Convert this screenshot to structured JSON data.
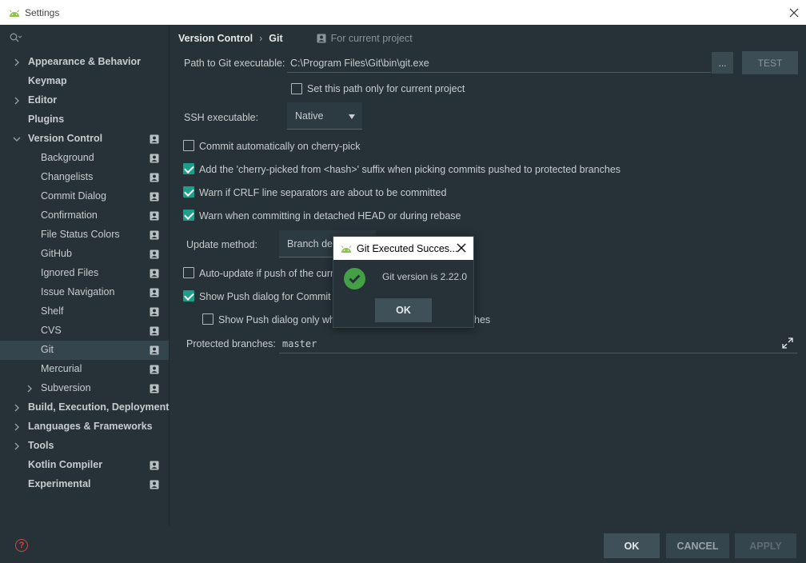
{
  "window": {
    "title": "Settings"
  },
  "sidebar": {
    "items": [
      {
        "label": "Appearance & Behavior",
        "bold": true,
        "level": 0,
        "chevron": "right",
        "project": false
      },
      {
        "label": "Keymap",
        "bold": true,
        "level": 0,
        "chevron": "none",
        "project": false
      },
      {
        "label": "Editor",
        "bold": true,
        "level": 0,
        "chevron": "right",
        "project": false
      },
      {
        "label": "Plugins",
        "bold": true,
        "level": 0,
        "chevron": "none",
        "project": false
      },
      {
        "label": "Version Control",
        "bold": true,
        "level": 0,
        "chevron": "down",
        "project": true
      },
      {
        "label": "Background",
        "bold": false,
        "level": 1,
        "chevron": "none",
        "project": true
      },
      {
        "label": "Changelists",
        "bold": false,
        "level": 1,
        "chevron": "none",
        "project": true
      },
      {
        "label": "Commit Dialog",
        "bold": false,
        "level": 1,
        "chevron": "none",
        "project": true
      },
      {
        "label": "Confirmation",
        "bold": false,
        "level": 1,
        "chevron": "none",
        "project": true
      },
      {
        "label": "File Status Colors",
        "bold": false,
        "level": 1,
        "chevron": "none",
        "project": true
      },
      {
        "label": "GitHub",
        "bold": false,
        "level": 1,
        "chevron": "none",
        "project": true
      },
      {
        "label": "Ignored Files",
        "bold": false,
        "level": 1,
        "chevron": "none",
        "project": true
      },
      {
        "label": "Issue Navigation",
        "bold": false,
        "level": 1,
        "chevron": "none",
        "project": true
      },
      {
        "label": "Shelf",
        "bold": false,
        "level": 1,
        "chevron": "none",
        "project": true
      },
      {
        "label": "CVS",
        "bold": false,
        "level": 1,
        "chevron": "none",
        "project": true
      },
      {
        "label": "Git",
        "bold": false,
        "level": 1,
        "chevron": "none",
        "project": true,
        "selected": true
      },
      {
        "label": "Mercurial",
        "bold": false,
        "level": 1,
        "chevron": "none",
        "project": true
      },
      {
        "label": "Subversion",
        "bold": false,
        "level": 1,
        "chevron": "right",
        "project": true
      },
      {
        "label": "Build, Execution, Deployment",
        "bold": true,
        "level": 0,
        "chevron": "right",
        "project": false
      },
      {
        "label": "Languages & Frameworks",
        "bold": true,
        "level": 0,
        "chevron": "right",
        "project": false
      },
      {
        "label": "Tools",
        "bold": true,
        "level": 0,
        "chevron": "right",
        "project": false
      },
      {
        "label": "Kotlin Compiler",
        "bold": true,
        "level": 0,
        "chevron": "none",
        "project": true
      },
      {
        "label": "Experimental",
        "bold": true,
        "level": 0,
        "chevron": "none",
        "project": true
      }
    ]
  },
  "breadcrumb": {
    "parent": "Version Control",
    "separator": "›",
    "current": "Git",
    "scope_note": "For current project"
  },
  "git": {
    "path_label": "Path to Git executable:",
    "path_value": "C:\\Program Files\\Git\\bin\\git.exe",
    "browse_label": "...",
    "test_label": "TEST",
    "path_only_project_label": "Set this path only for current project",
    "ssh_label": "SSH executable:",
    "ssh_value": "Native",
    "commit_cherry_pick_label": "Commit automatically on cherry-pick",
    "cherry_suffix_label": "Add the 'cherry-picked from <hash>' suffix when picking commits pushed to protected branches",
    "crlf_label": "Warn if CRLF line separators are about to be committed",
    "detached_label": "Warn when committing in detached HEAD or during rebase",
    "update_method_label": "Update method:",
    "update_method_value": "Branch def",
    "auto_update_label": "Auto-update if push of the curr",
    "show_push_label": "Show Push dialog for Commit a",
    "show_push_only_label_left": "Show Push dialog only whe",
    "show_push_only_label_right": "hes",
    "protected_label": "Protected branches:",
    "protected_value": "master"
  },
  "checks": {
    "path_only_project": false,
    "commit_cherry_pick": false,
    "cherry_suffix": true,
    "crlf": true,
    "detached": true,
    "auto_update": false,
    "show_push": true,
    "show_push_only": false
  },
  "dialog": {
    "title": "Git Executed Succes...",
    "message": "Git version is 2.22.0",
    "ok_label": "OK"
  },
  "footer": {
    "help": "?",
    "ok_label": "OK",
    "cancel_label": "CANCEL",
    "apply_label": "APPLY"
  },
  "colors": {
    "background": "#263238",
    "accent_check": "#1e9e89",
    "success": "#43a047",
    "help": "#d04848"
  }
}
